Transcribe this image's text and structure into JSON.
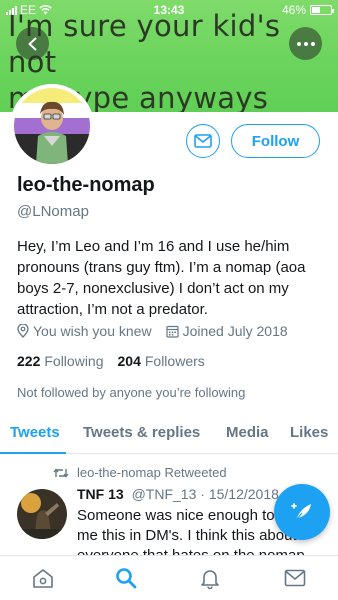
{
  "status_bar": {
    "carrier": "EE",
    "time": "13:43",
    "battery": "46%",
    "battery_level": 0.46
  },
  "banner": {
    "text": "I'm sure your kid's not\nmy type anyways",
    "background_color": "#6bd45d"
  },
  "profile": {
    "display_name": "leo-the-nomap",
    "handle": "@LNomap",
    "bio": "Hey, I’m Leo and I’m 16 and I use he/him pronouns (trans guy ftm). I’m a nomap (aoa boys 2-7, nonexclusive) I don’t act on my attraction, I’m not a predator.",
    "location": "You wish you knew",
    "joined": "Joined July 2018",
    "following_count": "222",
    "following_label": "Following",
    "followers_count": "204",
    "followers_label": "Followers",
    "not_followed_text": "Not followed by anyone you’re following"
  },
  "actions": {
    "follow_label": "Follow",
    "accent_color": "#1da1f2"
  },
  "tabs": [
    {
      "label": "Tweets",
      "active": true
    },
    {
      "label": "Tweets & replies",
      "active": false
    },
    {
      "label": "Media",
      "active": false
    },
    {
      "label": "Likes",
      "active": false
    }
  ],
  "tweet": {
    "retweet_label": "leo-the-nomap Retweeted",
    "author_name": "TNF 13",
    "author_handle": "@TNF_13",
    "date": "· 15/12/2018",
    "text": "Someone was nice enough to send me this in DM's. I think this about everyone that hates on the nomap community."
  },
  "icons": {
    "back": "chevron-left-icon",
    "more": "more-dots-icon",
    "message": "envelope-icon",
    "location": "location-pin-icon",
    "calendar": "calendar-icon",
    "retweet": "retweet-icon",
    "compose": "compose-feather-icon",
    "nav": [
      "home-icon",
      "search-icon",
      "notifications-bell-icon",
      "messages-envelope-icon"
    ]
  },
  "nav": {
    "active": "search"
  }
}
